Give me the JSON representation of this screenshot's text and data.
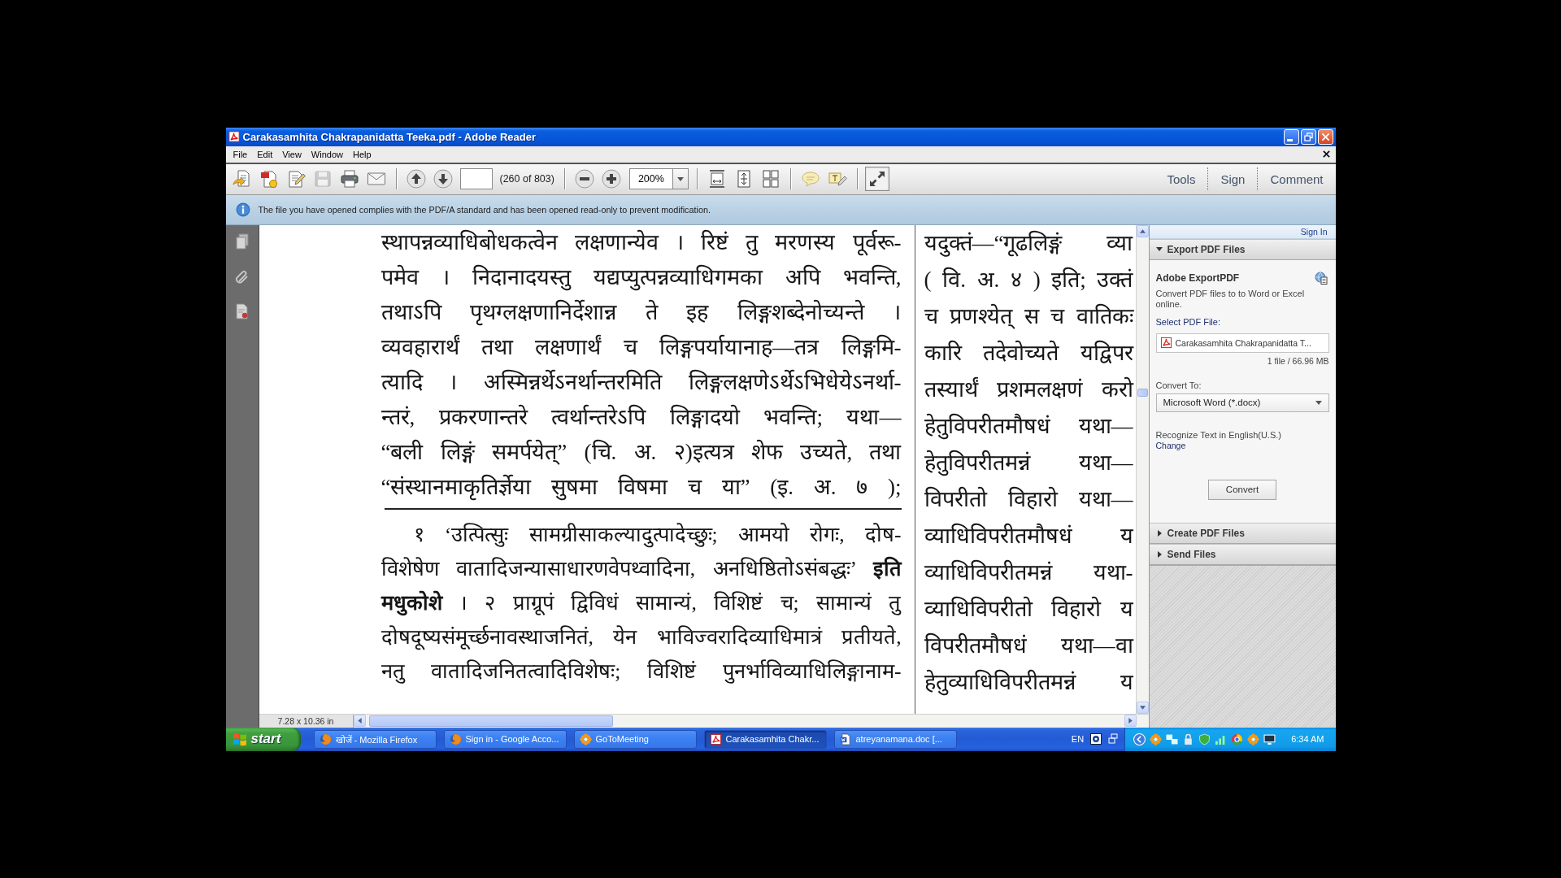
{
  "window": {
    "title": "Carakasamhita Chakrapanidatta Teeka.pdf - Adobe Reader"
  },
  "menu": [
    "File",
    "Edit",
    "View",
    "Window",
    "Help"
  ],
  "toolbar": {
    "file_buttons": [
      {
        "kind": "create-pdf",
        "disabled": false
      },
      {
        "kind": "pdf-tools",
        "disabled": false
      },
      {
        "kind": "edit",
        "disabled": false
      },
      {
        "kind": "save",
        "disabled": true
      },
      {
        "kind": "print",
        "disabled": false
      },
      {
        "kind": "email",
        "disabled": false
      }
    ],
    "navigation": {
      "buttons": [
        {
          "kind": "page-up"
        },
        {
          "kind": "page-down"
        }
      ],
      "page_count": "(260 of 803)"
    },
    "zoom": {
      "buttons": [
        {
          "kind": "zoom-out"
        },
        {
          "kind": "zoom-in"
        }
      ],
      "value": "200%"
    },
    "view_buttons": [
      {
        "kind": "fit-width"
      },
      {
        "kind": "fit-page"
      },
      {
        "kind": "scroll-mode"
      }
    ],
    "annotation_buttons": [
      {
        "kind": "comment"
      },
      {
        "kind": "typewriter"
      }
    ],
    "mode_buttons": [
      {
        "kind": "full-screen",
        "pressed": true
      }
    ],
    "tabs": [
      {
        "label": "Tools"
      },
      {
        "label": "Sign"
      },
      {
        "label": "Comment"
      }
    ]
  },
  "info_bar": {
    "message": "The file you have opened complies with the PDF/A standard and has been opened read-only to prevent modification."
  },
  "document": {
    "left_page": {
      "body_lines": [
        "स्थापन्नव्याधिबोधकत्वेन लक्षणान्येव । रिष्टं तु मरणस्य पूर्वरू-",
        "पमेव । निदानादयस्तु यद्यप्युत्पन्नव्याधिगमका अपि भवन्ति,",
        "तथाऽपि पृथग्लक्षणानिर्देशान्न ते इह लिङ्गशब्देनोच्यन्ते ।",
        "व्यवहारार्थं तथा लक्षणार्थं च लिङ्गपर्यायानाह—तत्र लिङ्गमि-",
        "त्यादि । अस्मिन्नर्थेऽनर्थान्तरमिति लिङ्गलक्षणेऽर्थेऽभिधेयेऽनर्था-",
        "न्तरं, प्रकरणान्तरे त्वर्थान्तरेऽपि लिङ्गादयो भवन्ति; यथा—",
        "“बली लिङ्गं समर्पयेत्” (चि. अ. २)इत्यत्र शेफ उच्यते, तथा",
        "“संस्थानमाकृतिर्ज्ञेया सुषमा विषमा च या” (इ. अ. ७ );"
      ],
      "footnote_lines": [
        "१ ‘उत्पित्सुः सामग्रीसाकल्यादुत्पादेच्छुः; आमयो रोगः, दोष-",
        "विशेषेण वातादिजन्यासाधारणवेपथ्वादिना, अनधिष्ठितोऽसंबद्धः’ **इति**",
        "**मधुकोशे** । २ प्राग्रूपं द्विविधं सामान्यं, विशिष्टं च; सामान्यं तु",
        "दोषदूष्यसंमूर्च्छनावस्थाजनितं, येन भाविज्वरादिव्याधिमात्रं प्रतीयते,",
        "नतु वातादिजनितत्वादिविशेषः; विशिष्टं पुनर्भाविव्याधिलिङ्गानाम-"
      ]
    },
    "right_page": {
      "lines": [
        "यदुक्तं—“गूढलिङ्गं व्या",
        "( वि. अ. ४ ) इति; उक्तं",
        "च प्रणश्येत् स च वातिकः",
        "कारि तदेवोच्यते यद्विपर",
        "तस्यार्थं प्रशमलक्षणं करो",
        "हेतुविपरीतमौषधं यथा—",
        "हेतुविपरीतमन्नं यथा—",
        "विपरीतो विहारो यथा—",
        "व्याधिविपरीतमौषधं य",
        "व्याधिविपरीतमन्नं यथा-",
        "व्याधिविपरीतो विहारो य",
        "विपरीतमौषधं यथा—वा",
        "हेतुव्याधिविपरीतमन्नं य"
      ]
    },
    "page_size": "7.28 x 10.36 in"
  },
  "right_panel": {
    "sign_in": "Sign In",
    "sections": [
      {
        "title": "Export PDF Files",
        "expanded": true,
        "content": {
          "heading": "Adobe ExportPDF",
          "description": "Convert PDF files to to Word or Excel online.",
          "select_label": "Select PDF File:",
          "file": "Carakasamhita Chakrapanidatta T...",
          "file_info": "1 file / 66.96 MB",
          "convert_to_label": "Convert To:",
          "format": "Microsoft Word (*.docx)",
          "ocr_text": "Recognize Text in English(U.S.)",
          "change_link": "Change",
          "convert_button": "Convert"
        }
      },
      {
        "title": "Create PDF Files",
        "expanded": false
      },
      {
        "title": "Send Files",
        "expanded": false
      }
    ]
  },
  "taskbar": {
    "start": "start",
    "items": [
      {
        "kind": "browser",
        "label": "खोजें - Mozilla Firefox",
        "selected": false
      },
      {
        "kind": "browser",
        "label": "Sign in - Google Acco...",
        "selected": false
      },
      {
        "kind": "meeting",
        "label": "GoToMeeting",
        "selected": false
      },
      {
        "kind": "pdf",
        "label": "Carakasamhita Chakr...",
        "selected": true
      },
      {
        "kind": "document",
        "label": "atreyanamana.doc [...",
        "selected": false
      }
    ],
    "language": "EN",
    "clock": "6:34 AM"
  }
}
